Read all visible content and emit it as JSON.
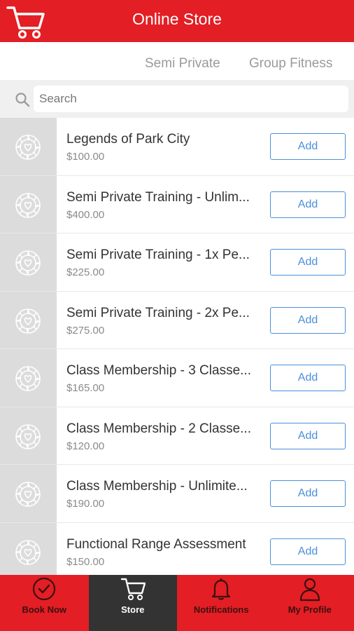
{
  "header": {
    "title": "Online Store",
    "icon": "cart-icon"
  },
  "tabs": [
    {
      "label": "Semi Private"
    },
    {
      "label": "Group Fitness"
    }
  ],
  "search": {
    "placeholder": "Search",
    "value": ""
  },
  "products": [
    {
      "name": "Legends of Park City",
      "price": "$100.00",
      "button": "Add"
    },
    {
      "name": "Semi Private Training - Unlim...",
      "price": "$400.00",
      "button": "Add"
    },
    {
      "name": "Semi Private Training - 1x Pe...",
      "price": "$225.00",
      "button": "Add"
    },
    {
      "name": "Semi Private Training - 2x Pe...",
      "price": "$275.00",
      "button": "Add"
    },
    {
      "name": "Class Membership - 3 Classe...",
      "price": "$165.00",
      "button": "Add"
    },
    {
      "name": "Class Membership - 2 Classe...",
      "price": "$120.00",
      "button": "Add"
    },
    {
      "name": "Class Membership - Unlimite...",
      "price": "$190.00",
      "button": "Add"
    },
    {
      "name": "Functional Range Assessment",
      "price": "$150.00",
      "button": "Add"
    }
  ],
  "bottom_nav": [
    {
      "label": "Book Now",
      "icon": "check-circle-icon",
      "active": false
    },
    {
      "label": "Store",
      "icon": "cart-icon",
      "active": true
    },
    {
      "label": "Notifications",
      "icon": "bell-icon",
      "active": false
    },
    {
      "label": "My Profile",
      "icon": "user-icon",
      "active": false
    }
  ],
  "colors": {
    "brand_red": "#e31e24",
    "active_nav": "#333333",
    "button_blue": "#4a90d9"
  }
}
